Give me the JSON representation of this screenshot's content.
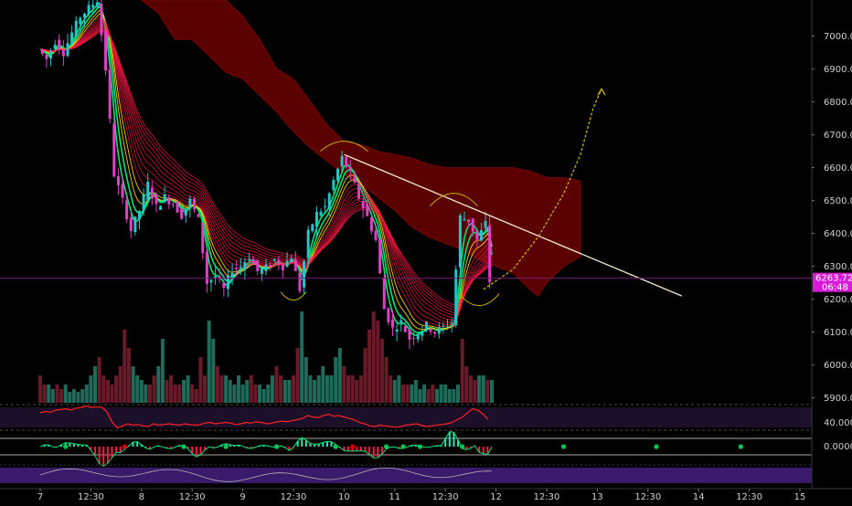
{
  "colors": {
    "background": "#000000",
    "cloud": "#5a0000",
    "cloud_edge": "#7a0505",
    "candle_up": "#22c7c7",
    "candle_down": "#e040c8",
    "ribbon_fast": "#00e676",
    "ribbon_slow": "#ff1744",
    "trendline": "#f2ead0",
    "projection": "#c8b400",
    "price_label_bg": "#d81bd8",
    "volume_up": "#1f6b5a",
    "volume_down": "#6b1a2a",
    "rsi_band": "#1c0f2a",
    "rsi_line": "#ff2020",
    "stoch_band": "#3a1a6a",
    "axis_text": "#cfcfcf"
  },
  "chart_data": {
    "type": "candlestick",
    "price_axis": {
      "ylim": [
        5885,
        7110
      ],
      "ticks": [
        "7000.00",
        "6900.00",
        "6800.00",
        "6700.00",
        "6600.00",
        "6500.00",
        "6400.00",
        "6300.00",
        "6200.00",
        "6100.00",
        "6000.00",
        "5900.00"
      ]
    },
    "time_axis": {
      "ticks": [
        {
          "t": 0,
          "label": "7"
        },
        {
          "t": 12,
          "label": "12:30"
        },
        {
          "t": 24,
          "label": "8"
        },
        {
          "t": 36,
          "label": "12:30"
        },
        {
          "t": 48,
          "label": "9"
        },
        {
          "t": 60,
          "label": "12:30"
        },
        {
          "t": 72,
          "label": "10"
        },
        {
          "t": 84,
          "label": "11"
        },
        {
          "t": 96,
          "label": "12:30"
        },
        {
          "t": 108,
          "label": "12"
        },
        {
          "t": 120,
          "label": "12:30"
        },
        {
          "t": 132,
          "label": "13"
        },
        {
          "t": 144,
          "label": "12:30"
        },
        {
          "t": 156,
          "label": "14"
        },
        {
          "t": 168,
          "label": "12:30"
        },
        {
          "t": 180,
          "label": "15"
        }
      ]
    },
    "price_path": [
      [
        0,
        6960
      ],
      [
        2,
        6930
      ],
      [
        4,
        6985
      ],
      [
        6,
        6950
      ],
      [
        8,
        7010
      ],
      [
        10,
        7060
      ],
      [
        12,
        7085
      ],
      [
        14,
        7110
      ],
      [
        16,
        6900
      ],
      [
        18,
        6580
      ],
      [
        20,
        6500
      ],
      [
        22,
        6410
      ],
      [
        24,
        6470
      ],
      [
        26,
        6550
      ],
      [
        28,
        6480
      ],
      [
        30,
        6510
      ],
      [
        32,
        6490
      ],
      [
        34,
        6455
      ],
      [
        36,
        6500
      ],
      [
        38,
        6440
      ],
      [
        40,
        6250
      ],
      [
        42,
        6270
      ],
      [
        44,
        6230
      ],
      [
        46,
        6290
      ],
      [
        48,
        6300
      ],
      [
        50,
        6330
      ],
      [
        52,
        6285
      ],
      [
        54,
        6295
      ],
      [
        56,
        6320
      ],
      [
        58,
        6300
      ],
      [
        60,
        6330
      ],
      [
        62,
        6230
      ],
      [
        64,
        6400
      ],
      [
        66,
        6460
      ],
      [
        68,
        6480
      ],
      [
        70,
        6560
      ],
      [
        72,
        6630
      ],
      [
        74,
        6580
      ],
      [
        76,
        6510
      ],
      [
        78,
        6450
      ],
      [
        80,
        6380
      ],
      [
        82,
        6170
      ],
      [
        84,
        6110
      ],
      [
        86,
        6130
      ],
      [
        88,
        6080
      ],
      [
        90,
        6100
      ],
      [
        92,
        6120
      ],
      [
        94,
        6100
      ],
      [
        96,
        6115
      ],
      [
        98,
        6130
      ],
      [
        100,
        6450
      ],
      [
        102,
        6440
      ],
      [
        104,
        6380
      ],
      [
        106,
        6430
      ],
      [
        107,
        6255
      ]
    ],
    "last_price": "6263.72",
    "countdown": "06:48",
    "cloud": [
      [
        24,
        7110,
        7110
      ],
      [
        28,
        7110,
        7070
      ],
      [
        32,
        7110,
        6990
      ],
      [
        36,
        7110,
        6990
      ],
      [
        40,
        7110,
        6940
      ],
      [
        44,
        7110,
        6890
      ],
      [
        48,
        7060,
        6870
      ],
      [
        52,
        6990,
        6820
      ],
      [
        56,
        6900,
        6770
      ],
      [
        60,
        6870,
        6710
      ],
      [
        64,
        6800,
        6660
      ],
      [
        68,
        6730,
        6620
      ],
      [
        72,
        6680,
        6580
      ],
      [
        76,
        6670,
        6550
      ],
      [
        80,
        6650,
        6510
      ],
      [
        84,
        6640,
        6470
      ],
      [
        88,
        6630,
        6420
      ],
      [
        92,
        6610,
        6390
      ],
      [
        96,
        6600,
        6370
      ],
      [
        100,
        6600,
        6350
      ],
      [
        104,
        6600,
        6320
      ],
      [
        108,
        6600,
        6300
      ],
      [
        112,
        6600,
        6280
      ],
      [
        116,
        6590,
        6230
      ],
      [
        118,
        6580,
        6210
      ],
      [
        120,
        6570,
        6250
      ],
      [
        124,
        6570,
        6300
      ],
      [
        128,
        6560,
        6330
      ]
    ],
    "trendline": {
      "from": [
        72,
        6640
      ],
      "to": [
        152,
        6210
      ]
    },
    "projection": [
      [
        105,
        6230
      ],
      [
        112,
        6290
      ],
      [
        118,
        6390
      ],
      [
        124,
        6520
      ],
      [
        128,
        6640
      ],
      [
        131,
        6780
      ],
      [
        133,
        6840
      ]
    ],
    "annotations": [
      {
        "label": "arc-1",
        "at": [
          60,
          6200
        ]
      },
      {
        "label": "arc-2",
        "at": [
          72,
          6650
        ]
      },
      {
        "label": "arc-3",
        "at": [
          98,
          6500
        ]
      },
      {
        "label": "arc-4",
        "at": [
          104,
          6200
        ]
      }
    ],
    "volume": [
      3,
      2,
      2,
      1.5,
      2,
      1.5,
      2,
      1.2,
      1.5,
      1.2,
      1.5,
      2,
      3,
      4,
      5,
      3,
      2.5,
      2,
      3,
      4,
      8,
      6,
      4,
      3,
      2.5,
      2,
      2,
      3,
      4,
      7,
      2.5,
      3,
      2,
      2,
      2.5,
      3,
      2,
      1.5,
      5,
      3,
      9,
      7,
      4,
      3,
      3,
      2.5,
      2,
      3,
      2,
      2.5,
      3,
      2,
      2,
      1.5,
      2,
      3,
      4,
      3,
      2.5,
      2.5,
      3,
      6,
      10,
      5,
      3,
      2.5,
      3,
      4,
      3,
      3,
      5,
      6,
      4,
      3,
      3,
      2.5,
      3,
      6,
      8,
      10,
      9,
      7,
      5,
      3,
      2.5,
      3,
      2,
      2,
      2,
      2.5,
      1.5,
      2,
      1.5,
      2,
      1.5,
      2,
      2,
      1.5,
      1.5,
      2,
      7,
      4,
      3,
      2.5,
      3,
      3,
      2.5,
      2.5
    ],
    "rsi_axis_tick": "40.0000",
    "rsi": [
      62,
      64,
      63,
      66,
      67,
      68,
      66,
      69,
      70,
      72,
      70,
      71,
      70,
      63,
      48,
      40,
      43,
      46,
      44,
      45,
      43,
      42,
      46,
      44,
      45,
      46,
      45,
      44,
      46,
      45,
      44,
      45,
      47,
      48,
      46,
      47,
      48,
      47,
      45,
      46,
      48,
      47,
      49,
      48,
      46,
      47,
      49,
      50,
      49,
      51,
      52,
      54,
      58,
      56,
      55,
      58,
      60,
      57,
      58,
      56,
      54,
      52,
      48,
      46,
      43,
      42,
      44,
      43,
      42,
      41,
      42,
      44,
      45,
      46,
      44,
      42,
      43,
      44,
      45,
      46,
      48,
      52,
      56,
      62,
      68,
      66,
      60,
      52
    ],
    "macd_axis_tick": "0.0000",
    "macd_signal_dots": [
      {
        "t": 6,
        "color": "#00c853"
      },
      {
        "t": 20,
        "color": "#d50000"
      },
      {
        "t": 34,
        "color": "#00c853"
      },
      {
        "t": 44,
        "color": "#00c853"
      },
      {
        "t": 56,
        "color": "#00c853"
      },
      {
        "t": 70,
        "color": "#00c853"
      },
      {
        "t": 74,
        "color": "#d50000"
      },
      {
        "t": 82,
        "color": "#00c853"
      },
      {
        "t": 86,
        "color": "#00c853"
      },
      {
        "t": 90,
        "color": "#00c853"
      },
      {
        "t": 100,
        "color": "#00c853"
      },
      {
        "t": 124,
        "color": "#00c853"
      },
      {
        "t": 146,
        "color": "#00c853"
      },
      {
        "t": 166,
        "color": "#00c853"
      }
    ]
  }
}
